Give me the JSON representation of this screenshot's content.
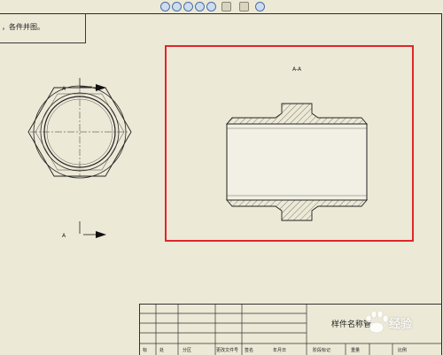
{
  "note": {
    "text": "，各件并图。"
  },
  "views": {
    "front": {
      "arrow_label_top": "A",
      "arrow_label_bottom": "A"
    },
    "section": {
      "title": "A-A"
    }
  },
  "title_block": {
    "part_name": "样件名称管",
    "bottom_labels": [
      "标",
      "处",
      "分区",
      "更改文件号",
      "签名",
      "年月日",
      "阶段标记",
      "重量",
      "比例"
    ]
  },
  "highlight": {
    "color": "#e0262c"
  },
  "watermark": {
    "text": "经验"
  },
  "toolbar": {
    "icons": [
      "zoom-in-icon",
      "zoom-out-icon",
      "zoom-fit-icon",
      "rotate-icon",
      "pan-icon",
      "view-icon",
      "display-icon",
      "settings-icon"
    ]
  }
}
